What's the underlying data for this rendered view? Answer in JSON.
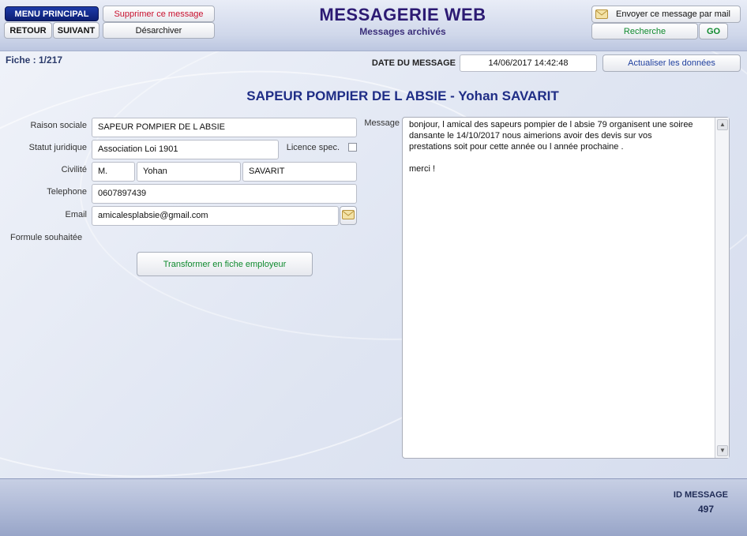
{
  "header": {
    "menu_principal": "MENU PRINCIPAL",
    "retour": "RETOUR",
    "suivant": "SUIVANT",
    "supprimer": "Supprimer ce message",
    "desarchiver": "Désarchiver",
    "app_title": "MESSAGERIE WEB",
    "app_subtitle": "Messages archivés",
    "envoyer_mail": "Envoyer ce message par mail",
    "recherche": "Recherche",
    "go": "GO"
  },
  "record": {
    "fiche_label": "Fiche : 1/217",
    "date_label": "DATE DU MESSAGE",
    "date_value": "14/06/2017 14:42:48",
    "actualiser": "Actualiser les données",
    "heading": "SAPEUR POMPIER DE L ABSIE  -  Yohan  SAVARIT"
  },
  "form": {
    "raison_sociale_label": "Raison sociale",
    "raison_sociale_value": "SAPEUR POMPIER DE L ABSIE",
    "statut_label": "Statut juridique",
    "statut_value": "Association Loi 1901",
    "licence_label": "Licence spec.",
    "licence_checked": false,
    "civilite_label": "Civilité",
    "civilite_value": "M.",
    "prenom_value": "Yohan",
    "nom_value": "SAVARIT",
    "telephone_label": "Telephone",
    "telephone_value": "0607897439",
    "email_label": "Email",
    "email_value": "amicalesplabsie@gmail.com",
    "formule_label": "Formule souhaitée",
    "transformer_button": "Transformer en fiche employeur"
  },
  "message": {
    "label": "Message",
    "body": "bonjour, l amical des sapeurs pompier de l absie 79 organisent une soiree\ndansante le 14/10/2017 nous aimerions avoir des devis sur vos\nprestations soit pour cette année ou l année prochaine .\n\nmerci !"
  },
  "footer": {
    "id_label": "ID MESSAGE",
    "id_value": "497"
  },
  "colors": {
    "accent": "#1f3f9e",
    "delete": "#c8102e",
    "green": "#0f8a2e",
    "title": "#2c1a73"
  }
}
